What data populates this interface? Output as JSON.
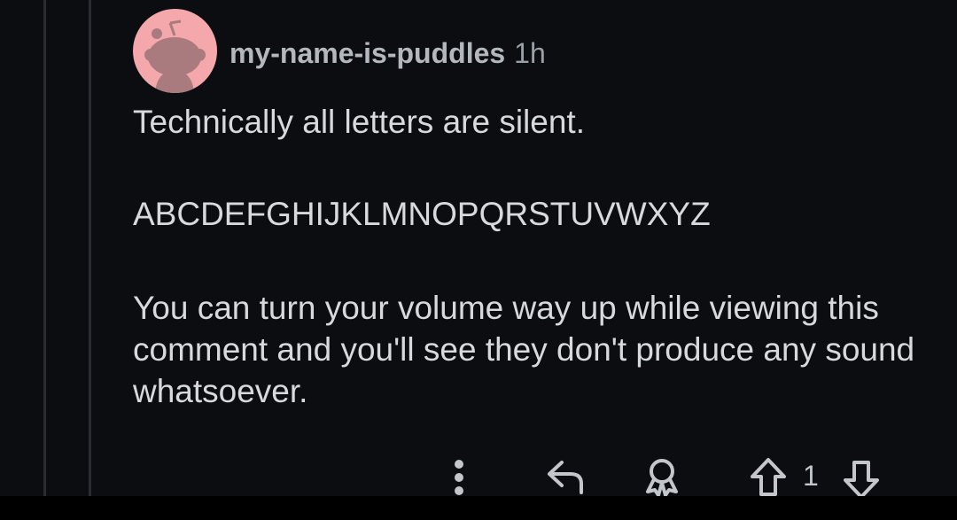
{
  "comment": {
    "author": "my-name-is-puddles",
    "age": "1h",
    "paragraphs": [
      "Technically all letters are silent.",
      "ABCDEFGHIJKLMNOPQRSTUVWXYZ",
      "You can turn your volume way up while viewing this comment and you'll see they don't produce any sound whatsoever."
    ],
    "vote_count": "1"
  },
  "actions": {
    "icons": [
      "more-options-icon",
      "reply-icon",
      "award-icon",
      "upvote-icon",
      "downvote-icon"
    ]
  },
  "colors": {
    "background": "#0b0d10",
    "text": "#d7dadc",
    "username": "#b3b8bd",
    "avatar_bg": "#f4a8ac",
    "thread_line": "#2a2d31"
  }
}
